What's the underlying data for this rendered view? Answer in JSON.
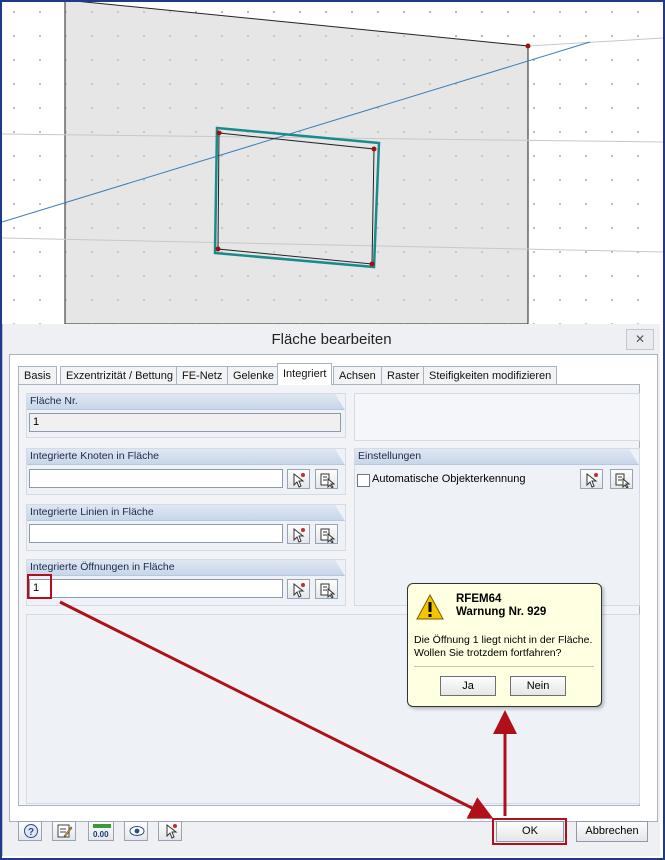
{
  "dialog": {
    "title": "Fläche bearbeiten",
    "close_label": "✕"
  },
  "tabs": [
    {
      "label": "Basis",
      "active": false
    },
    {
      "label": "Exzentrizität / Bettung",
      "active": false
    },
    {
      "label": "FE-Netz",
      "active": false
    },
    {
      "label": "Gelenke",
      "active": false
    },
    {
      "label": "Integriert",
      "active": true
    },
    {
      "label": "Achsen",
      "active": false
    },
    {
      "label": "Raster",
      "active": false
    },
    {
      "label": "Steifigkeiten modifizieren",
      "active": false
    }
  ],
  "surface_no": {
    "header": "Fläche Nr.",
    "value": "1"
  },
  "integrated_nodes": {
    "header": "Integrierte Knoten in Fläche",
    "value": ""
  },
  "integrated_lines": {
    "header": "Integrierte Linien in Fläche",
    "value": ""
  },
  "integrated_openings": {
    "header": "Integrierte Öffnungen in Fläche",
    "value": "1"
  },
  "settings": {
    "header": "Einstellungen",
    "auto_detect_label": "Automatische Objekterkennung",
    "auto_detect_checked": false
  },
  "footer": {
    "ok_label": "OK",
    "cancel_label": "Abbrechen",
    "zero_icon_text": "0.00"
  },
  "warning": {
    "app": "RFEM64",
    "title": "Warnung Nr. 929",
    "message_line1": "Die Öffnung 1 liegt nicht in der Fläche.",
    "message_line2": "Wollen Sie trotzdem fortfahren?",
    "yes_label": "Ja",
    "no_label": "Nein"
  },
  "colors": {
    "highlight": "#b0101a",
    "opening_outline": "#1a8a8a",
    "frame_border": "#1f3a8a"
  }
}
